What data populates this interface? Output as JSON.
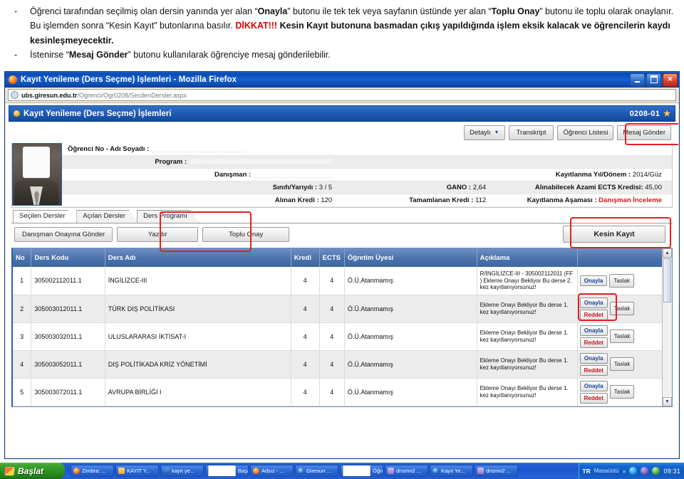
{
  "document_notes": {
    "bullets": [
      {
        "dash": "-",
        "segments": [
          {
            "t": "Öğrenci tarafından seçilmiş olan dersin yanında yer alan “",
            "s": "n"
          },
          {
            "t": "Onayla",
            "s": "b"
          },
          {
            "t": "” butonu ile tek tek veya sayfanın  üstünde yer alan “",
            "s": "n"
          },
          {
            "t": "Toplu Onay",
            "s": "b"
          },
          {
            "t": "” butonu ile toplu olarak onaylanır.  Bu işlemden  sonra “Kesin Kayıt” butonlarına basılır. ",
            "s": "n"
          },
          {
            "t": "DİKKAT!!!",
            "s": "r"
          },
          {
            "t": " Kesin Kayıt butonuna basmadan çıkış yapıldığında işlem eksik kalacak ve öğrencilerin kaydı kesinleşmeyecektir.",
            "s": "b"
          }
        ]
      },
      {
        "dash": "-",
        "segments": [
          {
            "t": "İstenirse “",
            "s": "n"
          },
          {
            "t": "Mesaj Gönder",
            "s": "b"
          },
          {
            "t": "” butonu kullanılarak öğrenciye mesaj gönderilebilir.",
            "s": "n"
          }
        ]
      }
    ]
  },
  "browser": {
    "title": "Kayıt Yenileme (Ders Seçme) İşlemleri - Mozilla Firefox",
    "window_controls": {
      "minimize": "Küçült",
      "maximize": "Büyüt",
      "close": "Kapat"
    },
    "url_host": "ubs.giresun.edu.tr",
    "url_path": "/Ogrenci/Ogr0208/SecilenDersler.aspx"
  },
  "page_header": {
    "title": "Kayıt Yenileme (Ders Seçme) İşlemleri",
    "code": "0208-01",
    "star": "★"
  },
  "toolbar": {
    "detayli": "Detaylı",
    "detayli_caret": "▼",
    "transkript": "Transkript",
    "ogrenci_listesi": "Öğrenci Listesi",
    "mesaj_gonder": "Mesaj Gönder"
  },
  "student_info": {
    "rows": [
      {
        "label": "Öğrenci No - Adı Soyadı :",
        "value": "",
        "redacted": true,
        "mid_label": "",
        "mid_value": "",
        "right_label": "",
        "right_value": ""
      },
      {
        "label": "Program :",
        "value": "",
        "redacted": true,
        "mid_label": "",
        "mid_value": "",
        "right_label": "",
        "right_value": ""
      },
      {
        "label": "Danışman :",
        "value": "",
        "redacted": true,
        "mid_label": "",
        "mid_value": "",
        "right_label": "Kayıtlanma Yıl/Dönem :",
        "right_value": "2014/Güz"
      },
      {
        "label": "Sınıfı/Yarıyılı :",
        "value": "3 / 5",
        "redacted": false,
        "mid_label": "GANO :",
        "mid_value": "2,64",
        "right_label": "Alınabilecek Azami ECTS Kredisi:",
        "right_value": "45,00"
      },
      {
        "label": "Alınan Kredi :",
        "value": "120",
        "redacted": false,
        "mid_label": "Tamamlanan Kredi :",
        "mid_value": "112",
        "right_label": "Kayıtlanma Aşaması :",
        "right_value": "Danışman İnceleme",
        "right_red": true
      }
    ]
  },
  "tabs": [
    {
      "label": "Seçilen Dersler",
      "active": true
    },
    {
      "label": "Açılan Dersler",
      "active": false
    },
    {
      "label": "Ders Programı",
      "active": false
    }
  ],
  "action_buttons": {
    "danisman_onayina_gonder": "Danışman Onayına Gönder",
    "yazdir": "Yazdır",
    "toplu_onay": "Toplu Onay",
    "kesin_kayit": "Kesin Kayıt"
  },
  "table": {
    "headers": [
      "No",
      "Ders Kodu",
      "Ders Adı",
      "Kredi",
      "ECTS",
      "Öğretim Üyesi",
      "Açıklama",
      ""
    ],
    "rows": [
      {
        "no": "1",
        "ders_kodu": "305002112011.1",
        "ders_adi": "İNGİLİZCE-III",
        "kredi": "4",
        "ects": "4",
        "ogretim_uyesi": "Ö.Ü.Atanmamış",
        "aciklama": "R/İNGİLİZCE-III - 305002112011 (FF ) Ekleme Onayı Bekliyor Bu derse 2. kez kayıtlanıyorsunuz!",
        "buttons": {
          "onayla": "Onayla",
          "reddet": "",
          "taslak": "Taslak"
        }
      },
      {
        "no": "2",
        "ders_kodu": "305003012011.1",
        "ders_adi": "TÜRK DIŞ POLİTİKASI",
        "kredi": "4",
        "ects": "4",
        "ogretim_uyesi": "Ö.Ü.Atanmamış",
        "aciklama": "Ekleme Onayı Bekliyor Bu derse 1. kez kayıtlanıyorsunuz!",
        "buttons": {
          "onayla": "Onayla",
          "reddet": "Reddet",
          "taslak": "Taslak"
        }
      },
      {
        "no": "3",
        "ders_kodu": "305003032011.1",
        "ders_adi": "ULUSLARARASI İKTİSAT-I",
        "kredi": "4",
        "ects": "4",
        "ogretim_uyesi": "Ö.Ü.Atanmamış",
        "aciklama": "Ekleme Onayı Bekliyor Bu derse 1. kez kayıtlanıyorsunuz!",
        "buttons": {
          "onayla": "Onayla",
          "reddet": "Reddet",
          "taslak": "Taslak"
        }
      },
      {
        "no": "4",
        "ders_kodu": "305003052011.1",
        "ders_adi": "DIŞ POLİTİKADA KRİZ YÖNETİMİ",
        "kredi": "4",
        "ects": "4",
        "ogretim_uyesi": "Ö.Ü.Atanmamış",
        "aciklama": "Ekleme Onayı Bekliyor Bu derse 1. kez kayıtlanıyorsunuz!",
        "buttons": {
          "onayla": "Onayla",
          "reddet": "Reddet",
          "taslak": "Taslak"
        }
      },
      {
        "no": "5",
        "ders_kodu": "305003072011.1",
        "ders_adi": "AVRUPA BİRLİĞİ I",
        "kredi": "4",
        "ects": "4",
        "ogretim_uyesi": "Ö.Ü.Atanmamış",
        "aciklama": "Ekleme Onayı Bekliyor Bu derse 1. kez kayıtlanıyorsunuz!",
        "buttons": {
          "onayla": "Onayla",
          "reddet": "Reddet",
          "taslak": "Taslak"
        }
      }
    ]
  },
  "scrollbar": {
    "up": "▲",
    "down": "▼"
  },
  "taskbar": {
    "start": "Başlat",
    "items": [
      {
        "label": "Zimbra: ...",
        "icon": "ff"
      },
      {
        "label": "KAYIT Y...",
        "icon": "folder"
      },
      {
        "label": "kayıt ye...",
        "icon": "word"
      },
      {
        "label": "Başarı D...",
        "icon": "doc"
      },
      {
        "label": "Adsız - ...",
        "icon": "ff"
      },
      {
        "label": "Giresun ...",
        "icon": "ie"
      },
      {
        "label": "Öğretim...",
        "icon": "doc"
      },
      {
        "label": "dnsmn2 ...",
        "icon": "pur"
      },
      {
        "label": "Kayıt Ye...",
        "icon": "ie"
      },
      {
        "label": "dnsmn2 ...",
        "icon": "pur"
      }
    ],
    "lang": "TR",
    "desktop": "Masaüstü",
    "chevron": "»",
    "clock": "09:31"
  },
  "annotations": {
    "accent_red": "#e32020",
    "boxes": [
      "mesaj-gonder",
      "toplu-onay",
      "kesin-kayit",
      "row2-actions"
    ]
  }
}
